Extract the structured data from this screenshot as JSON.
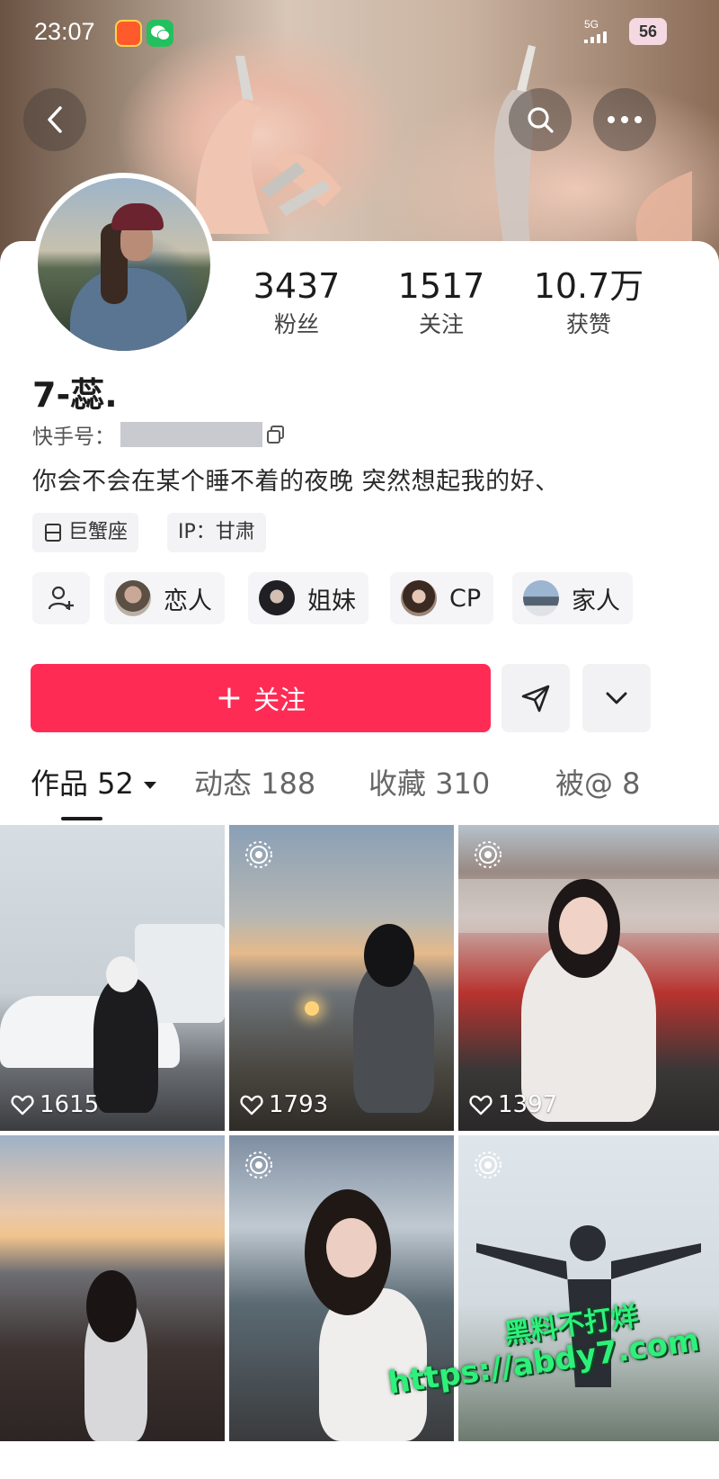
{
  "status_bar": {
    "time": "23:07",
    "network": "5G",
    "battery": "56"
  },
  "header": {
    "icons": [
      "back-icon",
      "search-icon",
      "more-icon"
    ]
  },
  "profile": {
    "stats": [
      {
        "value": "3437",
        "label": "粉丝"
      },
      {
        "value": "1517",
        "label": "关注"
      },
      {
        "value": "10.7万",
        "label": "获赞"
      }
    ],
    "username": "7-蕊.",
    "id_label": "快手号：",
    "bio": "你会不会在某个睡不着的夜晚 突然想起我的好、",
    "tags": [
      {
        "icon": "zodiac-icon",
        "text": "巨蟹座"
      },
      {
        "text": "IP：甘肃"
      }
    ],
    "relations": [
      {
        "label": "恋人"
      },
      {
        "label": "姐妹"
      },
      {
        "label": "CP"
      },
      {
        "label": "家人"
      }
    ],
    "follow_label": "关注",
    "accent_color": "#fe2c55"
  },
  "tabs": [
    {
      "label": "作品 52",
      "active": true
    },
    {
      "label": "动态 188",
      "active": false
    },
    {
      "label": "收藏 310",
      "active": false
    },
    {
      "label": "被@ 8",
      "active": false
    }
  ],
  "posts": [
    {
      "likes": "1615",
      "live": false
    },
    {
      "likes": "1793",
      "live": true
    },
    {
      "likes": "1397",
      "live": true
    },
    {
      "likes": "",
      "live": false
    },
    {
      "likes": "",
      "live": true
    },
    {
      "likes": "",
      "live": true
    }
  ],
  "watermark": {
    "line1": "黑料不打烊",
    "line2": "https://abdy7.com"
  }
}
